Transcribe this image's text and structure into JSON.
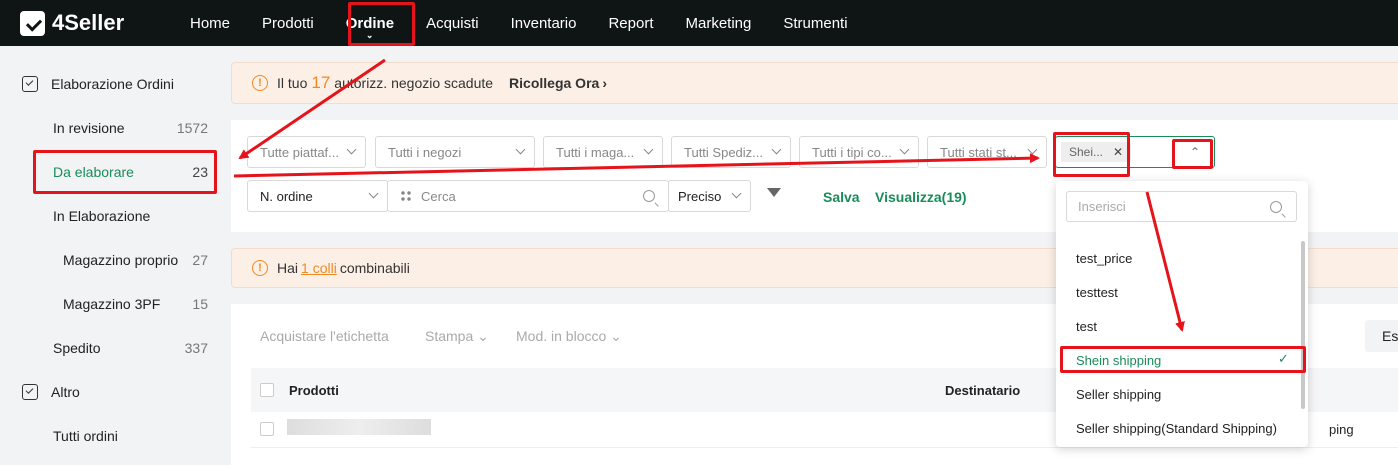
{
  "app": {
    "logo": "4Seller"
  },
  "nav": [
    {
      "label": "Home"
    },
    {
      "label": "Prodotti"
    },
    {
      "label": "Ordine",
      "active": true
    },
    {
      "label": "Acquisti"
    },
    {
      "label": "Inventario"
    },
    {
      "label": "Report"
    },
    {
      "label": "Marketing"
    },
    {
      "label": "Strumenti"
    }
  ],
  "sidebar": {
    "group1": "Elaborazione Ordini",
    "items": [
      {
        "label": "In revisione",
        "count": "1572"
      },
      {
        "label": "Da elaborare",
        "count": "23"
      },
      {
        "label": "In Elaborazione",
        "count": ""
      },
      {
        "label": "Magazzino proprio",
        "count": "27"
      },
      {
        "label": "Magazzino 3PF",
        "count": "15"
      },
      {
        "label": "Spedito",
        "count": "337"
      }
    ],
    "group2": "Altro",
    "other_items": [
      {
        "label": "Tutti ordini"
      }
    ]
  },
  "notice1": {
    "prefix": "Il tuo",
    "number": "17",
    "suffix": "autorizz. negozio scadute",
    "link": "Ricollega Ora"
  },
  "filters": {
    "platform": "Tutte piattaf...",
    "shops": "Tutti i negozi",
    "warehouses": "Tutti i maga...",
    "shipping": "Tutti Spediz...",
    "types": "Tutti i tipi co...",
    "status": "Tutti stati st...",
    "selected_tag": "Shei...",
    "order_field": "N. ordine",
    "search_placeholder": "Cerca",
    "match": "Preciso",
    "save": "Salva",
    "view": "Visualizza(19)"
  },
  "notice2": {
    "prefix": "Hai",
    "link": "1 colli",
    "suffix": "combinabili"
  },
  "toolbar": {
    "buy_label": "Acquistare l'etichetta",
    "print": "Stampa",
    "bulk": "Mod. in blocco",
    "right_btn": "Es"
  },
  "table": {
    "col_products": "Prodotti",
    "col_recipient": "Destinatario",
    "row_partial": "ping"
  },
  "dropdown": {
    "placeholder": "Inserisci",
    "options": [
      "test_price",
      "testtest",
      "test",
      "Shein shipping",
      "Seller shipping",
      "Seller shipping(Standard Shipping)"
    ],
    "selected_index": 3
  },
  "colors": {
    "accent": "#1a8c5b",
    "warning": "#f08a24",
    "annotation": "#e5141b",
    "topbar": "#0f1414"
  }
}
